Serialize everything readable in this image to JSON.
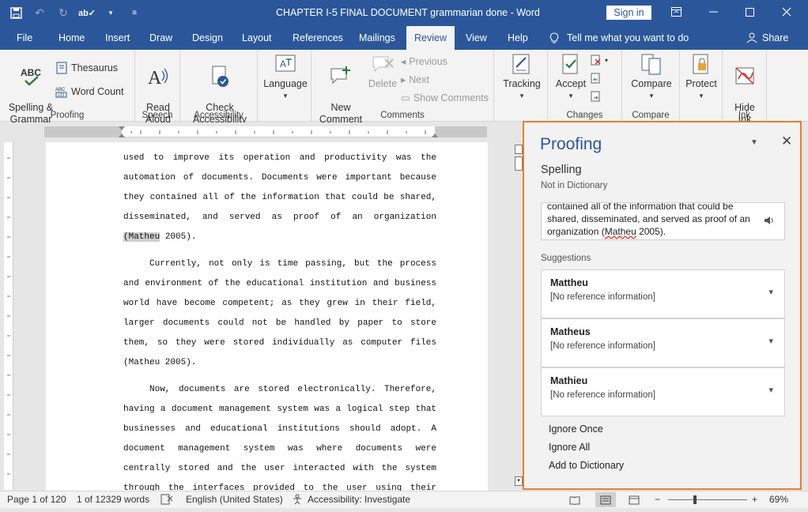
{
  "titlebar": {
    "title": "CHAPTER I-5 FINAL DOCUMENT  grammarian done  -  Word",
    "signin": "Sign in",
    "accent": "#2b579a"
  },
  "tabs": [
    {
      "label": "File"
    },
    {
      "label": "Home"
    },
    {
      "label": "Insert"
    },
    {
      "label": "Draw"
    },
    {
      "label": "Design"
    },
    {
      "label": "Layout"
    },
    {
      "label": "References"
    },
    {
      "label": "Mailings"
    },
    {
      "label": "Review"
    },
    {
      "label": "View"
    },
    {
      "label": "Help"
    }
  ],
  "tellme": "Tell me what you want to do",
  "share": "Share",
  "ribbon": {
    "spelling": "Spelling &\nGrammar",
    "thesaurus": "Thesaurus",
    "wordcount": "Word Count",
    "proofing_label": "Proofing",
    "readaloud": "Read\nAloud",
    "speech_label": "Speech",
    "checkaccess": "Check\nAccessibility",
    "accessibility_label": "Accessibility",
    "language": "Language",
    "newcomment": "New\nComment",
    "delete": "Delete",
    "previous": "Previous",
    "next": "Next",
    "showcomments": "Show Comments",
    "comments_label": "Comments",
    "tracking": "Tracking",
    "accept": "Accept",
    "changes_label": "Changes",
    "compare": "Compare",
    "compare_label": "Compare",
    "protect": "Protect",
    "hideink": "Hide\nInk",
    "ink_label": "Ink"
  },
  "document": {
    "p1": "used to improve its operation and productivity was the automation of documents. Documents were important because they contained all of the information that could be shared, disseminated, and served as proof of an organization ",
    "p1_flag": "(Matheu",
    "p1_end": " 2005).",
    "p2": "Currently, not only is time passing, but the process and environment of the educational institution and business world have become competent; as they grew in their field, larger documents could not be handled by paper to store them, so they were stored individually as computer files (Matheu 2005).",
    "p3": "Now, documents are stored electronically. Therefore, having a document management system was a logical step that businesses and educational institutions should adopt. A document management system was where documents were centrally stored and the user interacted with the system through the interfaces provided to the user using their preferred web"
  },
  "proofing": {
    "title": "Proofing",
    "section": "Spelling",
    "subsection": "Not in Dictionary",
    "context_pre": "contained all of the information that could be shared, disseminated, and served as proof of an organization (",
    "context_flag": "Matheu",
    "context_post": " 2005).",
    "suggestions_label": "Suggestions",
    "suggestions": [
      {
        "word": "Mattheu",
        "info": "[No reference information]"
      },
      {
        "word": "Matheus",
        "info": "[No reference information]"
      },
      {
        "word": "Mathieu",
        "info": "[No reference information]"
      }
    ],
    "ignore_once": "Ignore Once",
    "ignore_all": "Ignore All",
    "add_dict": "Add to Dictionary",
    "border_color": "#ee7b30"
  },
  "status": {
    "page": "Page 1 of 120",
    "words": "1 of 12329 words",
    "language": "English (United States)",
    "accessibility": "Accessibility: Investigate",
    "zoom": "69%",
    "zoom_minus": "−",
    "zoom_plus": "+"
  }
}
